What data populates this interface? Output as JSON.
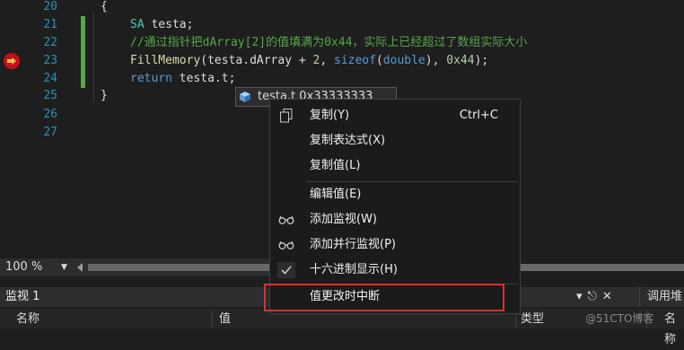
{
  "editor": {
    "lines": [
      {
        "num": "20",
        "code": "{"
      },
      {
        "num": "21",
        "type": "SA",
        "rest": " testa;"
      },
      {
        "num": "22",
        "comment": "//通过指针把dArray[2]的值填满为0x44，实际上已经超过了数组实际大小"
      },
      {
        "num": "23",
        "fn": "FillMemory",
        "p1": "(testa.dArray + ",
        "n1": "2",
        "p2": ", ",
        "kw1": "sizeof",
        "p3": "(",
        "kw2": "double",
        "p4": "), ",
        "n2": "0x44",
        "p5": ");"
      },
      {
        "num": "24",
        "kw": "return",
        "rest": " testa.t;"
      },
      {
        "num": "25",
        "code": "}"
      },
      {
        "num": "26",
        "code": ""
      },
      {
        "num": "27",
        "code": ""
      }
    ]
  },
  "datatip": {
    "text": "testa.t  0x33333333"
  },
  "context_menu": {
    "items": [
      {
        "label": "复制(Y)",
        "shortcut": "Ctrl+C",
        "icon": "copy-icon"
      },
      {
        "label": "复制表达式(X)"
      },
      {
        "label": "复制值(L)"
      },
      {
        "label": "编辑值(E)"
      },
      {
        "label": "添加监视(W)",
        "icon": "glasses-icon"
      },
      {
        "label": "添加并行监视(P)",
        "icon": "glasses-icon"
      },
      {
        "label": "十六进制显示(H)",
        "icon": "check-icon"
      },
      {
        "label": "值更改时中断"
      }
    ]
  },
  "status": {
    "zoom": "100 %"
  },
  "watch": {
    "title": "监视 1",
    "pin": "↓ 俣 ✕",
    "other_tab": "调用堆",
    "columns": [
      "名称",
      "值",
      "类型",
      "名称"
    ]
  },
  "watermark": "@51CTO博客",
  "colors": {
    "highlight_border": "#d9302c",
    "breakpoint": "#c50f1f"
  }
}
